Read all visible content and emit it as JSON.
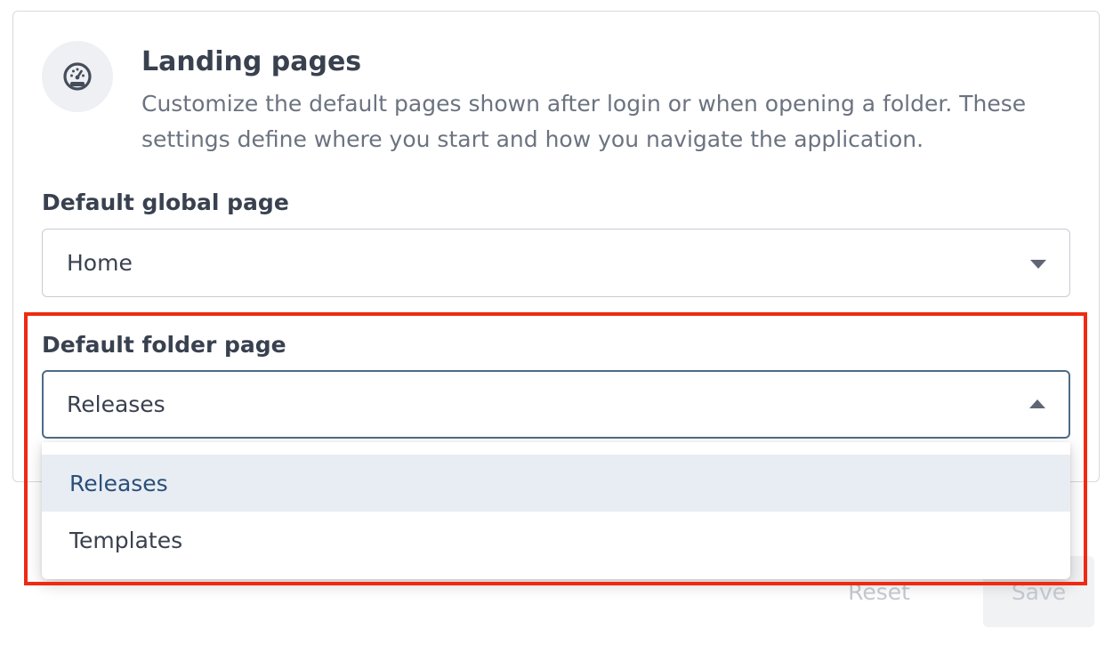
{
  "section": {
    "icon": "dashboard-gauge-icon",
    "title": "Landing pages",
    "description": "Customize the default pages shown after login or when opening a folder. These settings define where you start and how you navigate the application."
  },
  "global_page": {
    "label": "Default global page",
    "value": "Home"
  },
  "folder_page": {
    "label": "Default folder page",
    "value": "Releases",
    "options": [
      {
        "label": "Releases",
        "selected": true
      },
      {
        "label": "Templates",
        "selected": false
      }
    ]
  },
  "footer": {
    "reset_label": "Reset",
    "save_label": "Save"
  },
  "colors": {
    "selected_option_bg": "#e8edf3",
    "selected_option_text": "#2a4f7a",
    "highlight_border": "#ee2a12",
    "active_select_border": "#4d6b87"
  }
}
